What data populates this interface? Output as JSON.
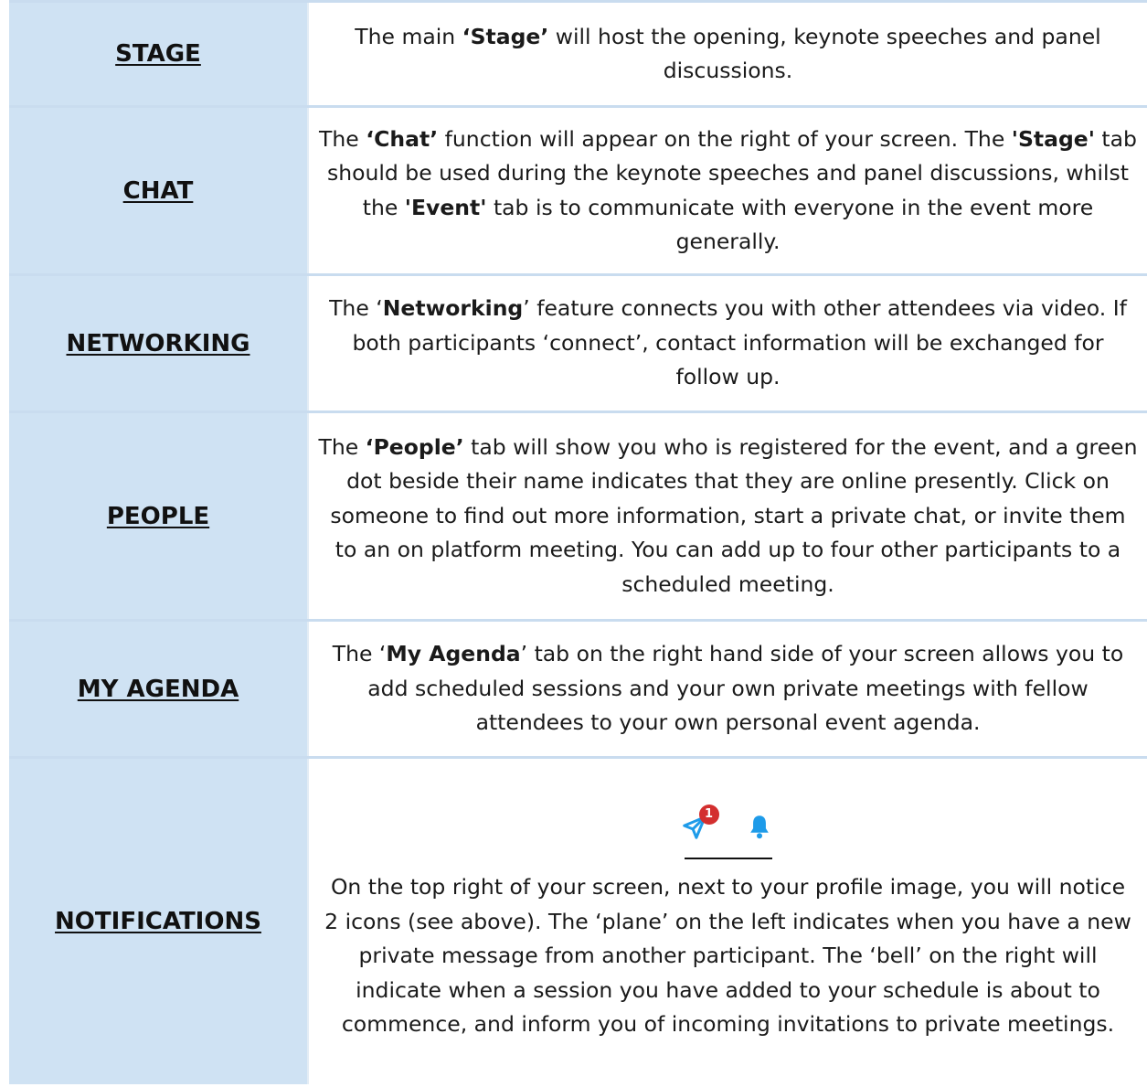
{
  "rows": [
    {
      "label": "STAGE",
      "parts": [
        {
          "t": "The main ",
          "b": false
        },
        {
          "t": "‘Stage’",
          "b": true
        },
        {
          "t": " will host the opening, keynote speeches and panel discussions.",
          "b": false
        }
      ]
    },
    {
      "label": "CHAT",
      "parts": [
        {
          "t": "The ",
          "b": false
        },
        {
          "t": "‘Chat’",
          "b": true
        },
        {
          "t": " function will appear on the right of your screen. The ",
          "b": false
        },
        {
          "t": "'Stage'",
          "b": true
        },
        {
          "t": " tab should be used during the keynote speeches and panel discussions, whilst the ",
          "b": false
        },
        {
          "t": "'Event'",
          "b": true
        },
        {
          "t": " tab is to communicate with everyone in the event more generally.",
          "b": false
        }
      ]
    },
    {
      "label": "NETWORKING",
      "parts": [
        {
          "t": "The ‘",
          "b": false
        },
        {
          "t": "Networking",
          "b": true
        },
        {
          "t": "’ feature connects you with other attendees via video. If both participants ‘connect’, contact information will be exchanged for follow up.",
          "b": false
        }
      ]
    },
    {
      "label": "PEOPLE",
      "parts": [
        {
          "t": "The ",
          "b": false
        },
        {
          "t": "‘People’",
          "b": true
        },
        {
          "t": " tab will show you who is registered for the event, and a green dot beside their name indicates that they are online presently. Click on someone to find out more information, start a private chat, or invite them to an on platform meeting. You can add up to four other participants to a scheduled meeting.",
          "b": false
        }
      ]
    },
    {
      "label": "MY AGENDA",
      "parts": [
        {
          "t": "The ‘",
          "b": false
        },
        {
          "t": "My Agenda",
          "b": true
        },
        {
          "t": "’ tab on the right hand side of your screen allows you to add scheduled sessions and your own private meetings with fellow attendees to your own personal event agenda.",
          "b": false
        }
      ]
    },
    {
      "label": "NOTIFICATIONS",
      "icons": {
        "plane_icon": "paper-plane-icon",
        "bell_icon": "bell-icon",
        "badge_count": "1",
        "icon_color": "#1e9be9",
        "badge_color": "#d32f2f"
      },
      "parts": [
        {
          "t": "On the top right of your screen, next to your profile image, you will notice 2 icons (see above). The ‘plane’ on the left indicates when you have a new private message from another participant. The ‘bell’ on the right will indicate when a session you have added to your schedule is about to commence, and inform you of incoming invitations to private meetings.",
          "b": false
        }
      ]
    }
  ]
}
